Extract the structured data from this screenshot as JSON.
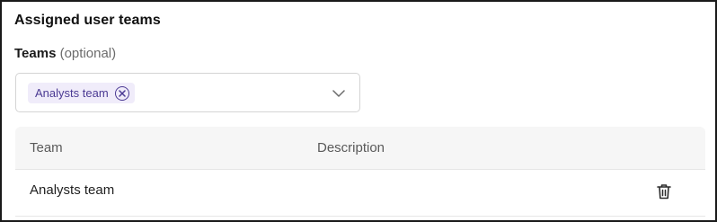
{
  "section": {
    "title": "Assigned user teams"
  },
  "teams_field": {
    "label": "Teams",
    "label_hint": "(optional)",
    "selected": [
      {
        "label": "Analysts team",
        "remove_icon": "close-circle-icon"
      }
    ],
    "dropdown_icon": "chevron-down-icon"
  },
  "table": {
    "columns": [
      "Team",
      "Description"
    ],
    "rows": [
      {
        "team": "Analysts team",
        "description": "",
        "action_icon": "trash-icon"
      }
    ]
  },
  "colors": {
    "chip_background": "#f0ecfa",
    "chip_text": "#4b3a93",
    "header_background": "#f6f6f6",
    "border": "#d4d4d4"
  }
}
